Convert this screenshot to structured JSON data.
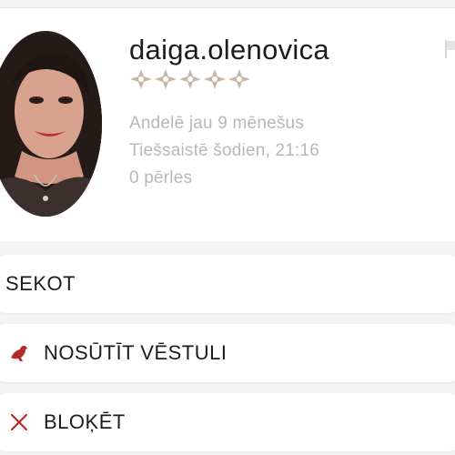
{
  "profile": {
    "username": "daiga.olenovica",
    "rating": 5,
    "meta": [
      "Andelē jau 9 mēnešus",
      "Tiešsaistē šodien, 21:16",
      "0 pērles"
    ]
  },
  "actions": {
    "follow_label": "SEKOT",
    "message_label": "NOSŪTĪT VĒSTULI",
    "block_label": "BLOĶĒT"
  },
  "icons": {
    "rating": "ornament-star-icon",
    "report": "flag-icon",
    "message": "bird-icon",
    "block": "close-icon"
  },
  "colors": {
    "star": "#c8b7a7",
    "accent": "#b52b2b",
    "meta_text": "#b8b8b8"
  }
}
